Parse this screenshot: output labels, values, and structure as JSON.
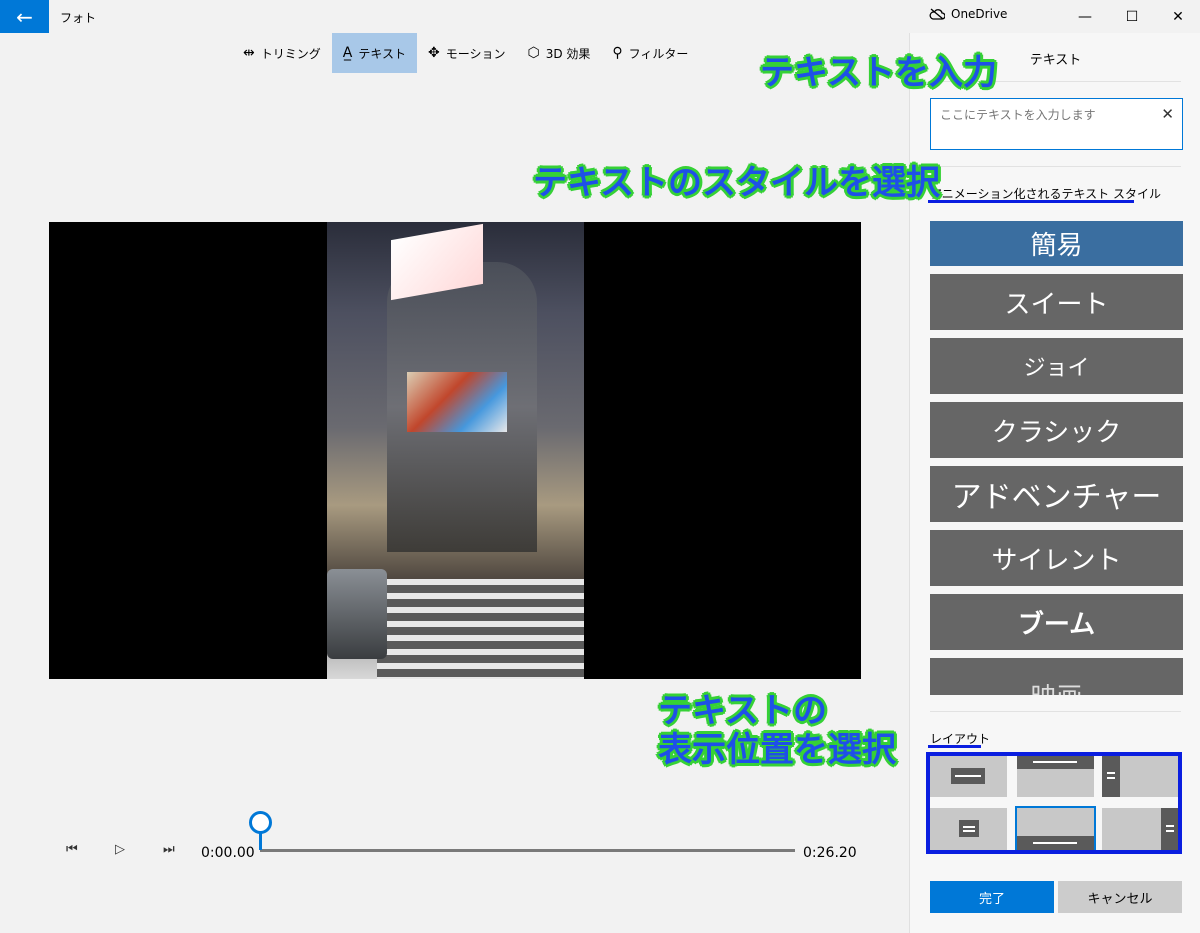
{
  "window": {
    "app_title": "フォト",
    "onedrive_label": "OneDrive",
    "back_glyph": "←",
    "minimize_glyph": "—",
    "maximize_glyph": "☐",
    "close_glyph": "✕"
  },
  "toolbar": {
    "items": [
      {
        "label": "トリミング",
        "icon": "trim-icon",
        "glyph": "⇹"
      },
      {
        "label": "テキスト",
        "icon": "text-icon",
        "glyph": "A̲",
        "active": true
      },
      {
        "label": "モーション",
        "icon": "motion-icon",
        "glyph": "✥"
      },
      {
        "label": "3D 効果",
        "icon": "3d-effects-icon",
        "glyph": "⬡"
      },
      {
        "label": "フィルター",
        "icon": "filter-icon",
        "glyph": "⚲"
      }
    ]
  },
  "timeline": {
    "current_time": "0:00.00",
    "total_time": "0:26.20",
    "progress": 0,
    "prev_glyph": "⏮",
    "play_glyph": "▷",
    "next_glyph": "⏭"
  },
  "panel": {
    "title": "テキスト",
    "input": {
      "value": "",
      "placeholder": "ここにテキストを入力します",
      "clear_glyph": "✕"
    },
    "style_section_label": "アニメーション化されるテキスト スタイル",
    "styles": [
      "簡易",
      "スイート",
      "ジョイ",
      "クラシック",
      "アドベンチャー",
      "サイレント",
      "ブーム",
      "映画"
    ],
    "selected_style": "簡易",
    "layout_section_label": "レイアウト",
    "done_label": "完了",
    "cancel_label": "キャンセル"
  },
  "annotations": {
    "input_text": "テキストを入力",
    "style_text": "テキストのスタイルを選択",
    "layout_text_line1": "テキストの",
    "layout_text_line2": "表示位置を選択"
  },
  "colors": {
    "accent": "#0078d7",
    "annotation_text": "#1e50e8",
    "annotation_outline": "#36d136",
    "annotation_mark": "#0a1ee0",
    "style_button": "#666666",
    "style_button_selected": "#3a6ea0"
  }
}
